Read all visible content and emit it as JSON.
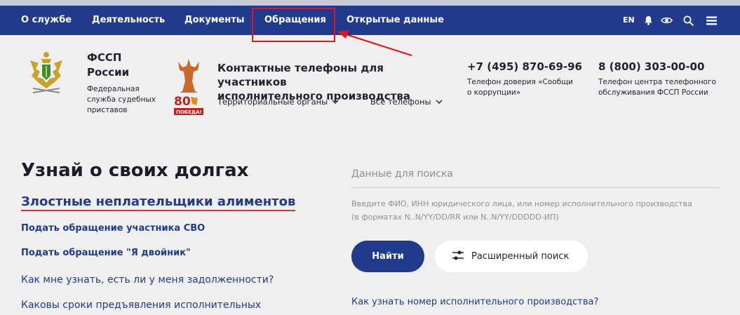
{
  "nav": {
    "items": [
      {
        "label": "О службе"
      },
      {
        "label": "Деятельность"
      },
      {
        "label": "Документы"
      },
      {
        "label": "Обращения"
      },
      {
        "label": "Открытые данные"
      }
    ],
    "lang": "EN",
    "icons": [
      "bell-icon",
      "eye-icon",
      "search-icon",
      "menu-icon"
    ]
  },
  "annotation": {
    "highlight_color": "#e3141b",
    "highlighted_item": "Обращения"
  },
  "org": {
    "name": "ФССП\nРоссии",
    "subtitle": "Федеральная\nслужба судебных\nприставов",
    "victory_badge": "80 ПОБЕДА!"
  },
  "contacts": {
    "title": "Контактные телефоны для участников\nисполнительного производства",
    "dropdown_territorial": "Территориальные органы",
    "dropdown_all": "Все телефоны",
    "phone1": "+7 (495) 870-69-96",
    "phone1_desc": "Телефон доверия «Сообщи\nо коррупции»",
    "phone2": "8 (800) 303-00-00",
    "phone2_desc": "Телефон центра телефонного\nобслуживания ФССП России"
  },
  "main": {
    "title": "Узнай о своих долгах",
    "link_alimony": "Злостные неплательщики алиментов",
    "link_svo": "Подать обращение участника СВО",
    "link_double": "Подать обращение \"Я двойник\"",
    "link_debts": "Как мне узнать, есть ли у меня задолженности?",
    "link_terms": "Каковы сроки предъявления исполнительных"
  },
  "search": {
    "placeholder": "Данные для поиска",
    "hint": "Введите ФИО, ИНН юридического лица, или номер исполнительного производства\n(в форматах N..N/YY/DD/RR или N..N/YY/DDDDD-ИП)",
    "find_label": "Найти",
    "advanced_label": "Расширенный поиск",
    "how_link": "Как узнать номер исполнительного производства?"
  },
  "colors": {
    "brand": "#223a8c",
    "background": "#efefef",
    "accent_red": "#e3141b"
  }
}
